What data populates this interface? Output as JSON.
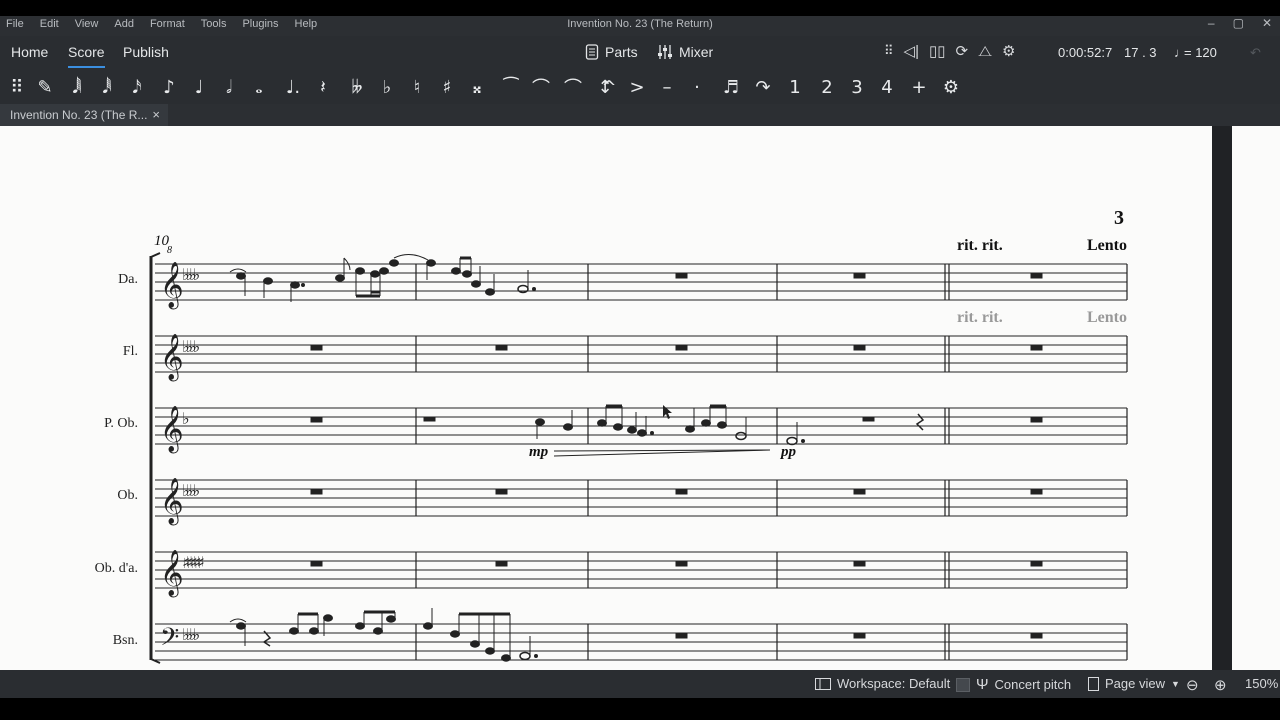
{
  "window": {
    "title": "Invention No. 23 (The Return)",
    "menu": [
      "File",
      "Edit",
      "View",
      "Add",
      "Format",
      "Tools",
      "Plugins",
      "Help"
    ]
  },
  "nav": {
    "tabs": [
      "Home",
      "Score",
      "Publish"
    ],
    "active_tab": "Score",
    "parts_label": "Parts",
    "mixer_label": "Mixer"
  },
  "playback": {
    "time": "0:00:52:7",
    "position": "17 . 3",
    "tempo": "= 120"
  },
  "toolbar": {
    "tools": [
      {
        "name": "input-handle",
        "glyph": "⠿"
      },
      {
        "name": "note-input-pencil",
        "glyph": "✎"
      },
      {
        "name": "duration-64th",
        "glyph": "𝅘𝅥𝅲"
      },
      {
        "name": "duration-32nd",
        "glyph": "𝅘𝅥𝅱"
      },
      {
        "name": "duration-16th",
        "glyph": "𝅘𝅥𝅯"
      },
      {
        "name": "duration-eighth",
        "glyph": "♪"
      },
      {
        "name": "duration-quarter",
        "glyph": "♩"
      },
      {
        "name": "duration-half",
        "glyph": "𝅗𝅥"
      },
      {
        "name": "duration-whole",
        "glyph": "𝅝"
      },
      {
        "name": "augmentation-dot",
        "glyph": "♩."
      },
      {
        "name": "rest",
        "glyph": "𝄽"
      },
      {
        "name": "double-flat",
        "glyph": "𝄫"
      },
      {
        "name": "flat",
        "glyph": "♭"
      },
      {
        "name": "natural",
        "glyph": "♮"
      },
      {
        "name": "sharp",
        "glyph": "♯"
      },
      {
        "name": "double-sharp",
        "glyph": "𝄪"
      },
      {
        "name": "tie",
        "glyph": "⁀"
      },
      {
        "name": "slur",
        "glyph": "⌒"
      },
      {
        "name": "tuplet",
        "glyph": "⌒"
      },
      {
        "name": "flip-direction",
        "glyph": "↕"
      },
      {
        "name": "marcato",
        "glyph": "^"
      },
      {
        "name": "accent",
        "glyph": ">"
      },
      {
        "name": "tenuto",
        "glyph": "–"
      },
      {
        "name": "staccato",
        "glyph": "·"
      },
      {
        "name": "tuplet-3",
        "glyph": "♬"
      },
      {
        "name": "flip",
        "glyph": "↷"
      },
      {
        "name": "voice-1",
        "glyph": "1"
      },
      {
        "name": "voice-2",
        "glyph": "2"
      },
      {
        "name": "voice-3",
        "glyph": "3"
      },
      {
        "name": "voice-4",
        "glyph": "4"
      },
      {
        "name": "add",
        "glyph": "+"
      },
      {
        "name": "customize",
        "glyph": "⚙"
      }
    ]
  },
  "document": {
    "tab_label": "Invention No. 23 (The R...",
    "close_glyph": "×"
  },
  "score": {
    "measure_number": "10",
    "page_number": "3",
    "rit_label": "rit. rit.",
    "tempo_label": "Lento",
    "dynamic_mp": "mp",
    "dynamic_pp": "pp",
    "octave_mark": "8",
    "instruments": [
      "Da.",
      "Fl.",
      "P. Ob.",
      "Ob.",
      "Ob. d'a.",
      "Bsn."
    ]
  },
  "status": {
    "workspace": "Workspace: Default",
    "concert_pitch": "Concert pitch",
    "view_mode": "Page view",
    "zoom": "150%"
  },
  "colors": {
    "accent": "#3b8fe0",
    "chrome": "#2a2d31",
    "paper": "#fbfbfa"
  }
}
